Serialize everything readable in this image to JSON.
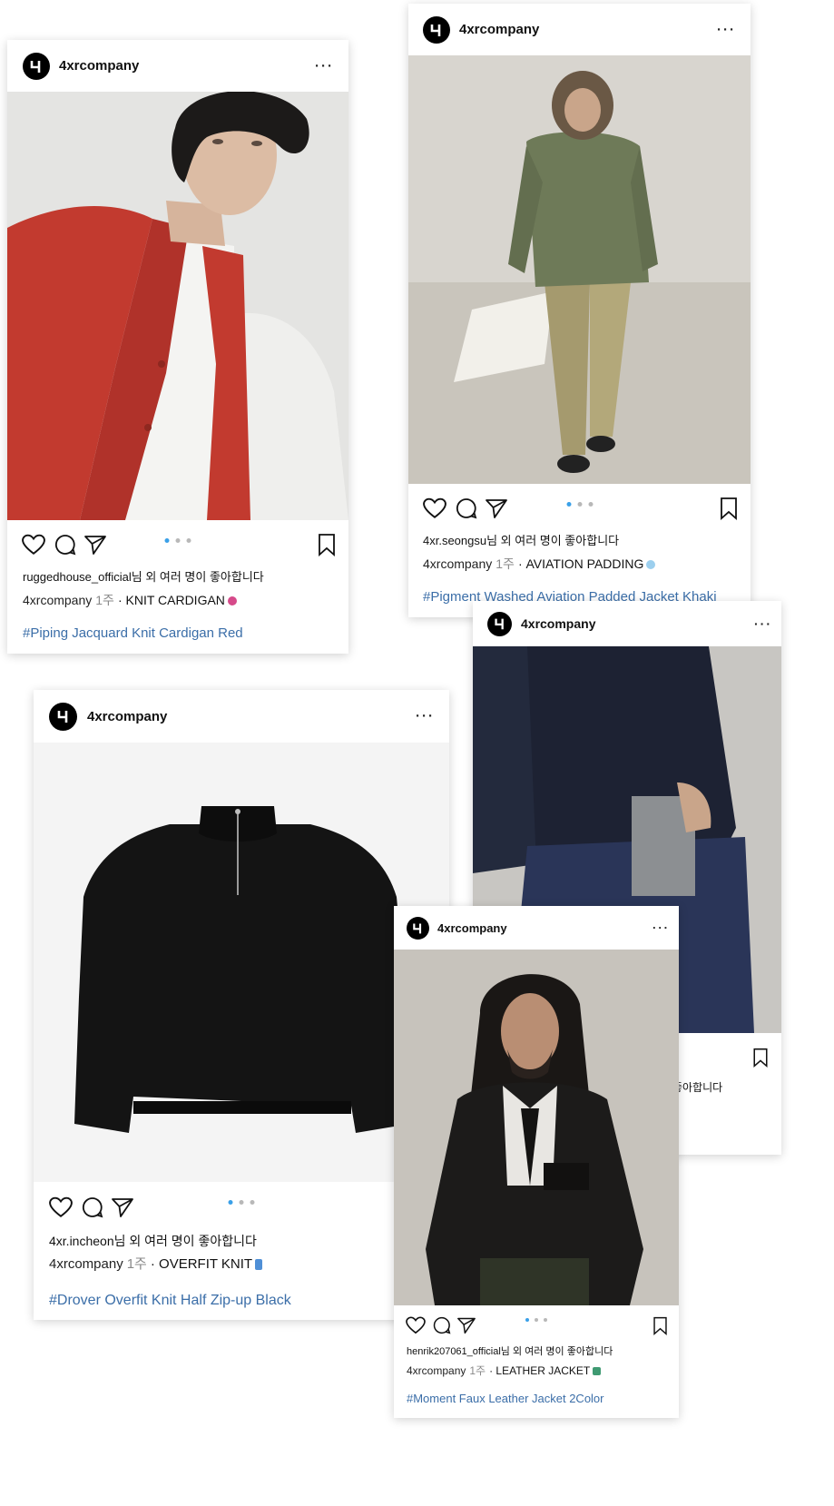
{
  "posts": [
    {
      "username": "4xrcompany",
      "likes": "ruggedhouse_official님 외 여러 명이 좋아합니다",
      "caption_user": "4xrcompany",
      "caption_time": "1주",
      "caption_text": "· KNIT CARDIGAN",
      "hashtag": "#Piping Jacquard Knit Cardigan Red",
      "more": "···"
    },
    {
      "username": "4xrcompany",
      "likes": "4xr.seongsu님 외 여러 명이 좋아합니다",
      "caption_user": "4xrcompany",
      "caption_time": "1주",
      "caption_text": "· AVIATION PADDING",
      "hashtag": "#Pigment Washed Aviation Padded Jacket Khaki",
      "more": "···"
    },
    {
      "username": "4xrcompany",
      "likes": "좋아합니다",
      "more": "···"
    },
    {
      "username": "4xrcompany",
      "likes": "4xr.incheon님 외 여러 명이 좋아합니다",
      "caption_user": "4xrcompany",
      "caption_time": "1주",
      "caption_text": "· OVERFIT KNIT",
      "hashtag": "#Drover Overfit Knit Half Zip-up Black",
      "more": "···"
    },
    {
      "username": "4xrcompany",
      "likes": "henrik207061_official님 외 여러 명이 좋아합니다",
      "caption_user": "4xrcompany",
      "caption_time": "1주",
      "caption_text": "· LEATHER JACKET",
      "hashtag": "#Moment Faux Leather Jacket 2Color",
      "more": "···"
    }
  ],
  "colors": {
    "accent": "#3aa0e8",
    "hashtag": "#3b6ea8",
    "muted": "#888888"
  },
  "icons": [
    "brand-logo-icon",
    "heart-icon",
    "comment-icon",
    "share-icon",
    "bookmark-icon",
    "more-icon"
  ]
}
